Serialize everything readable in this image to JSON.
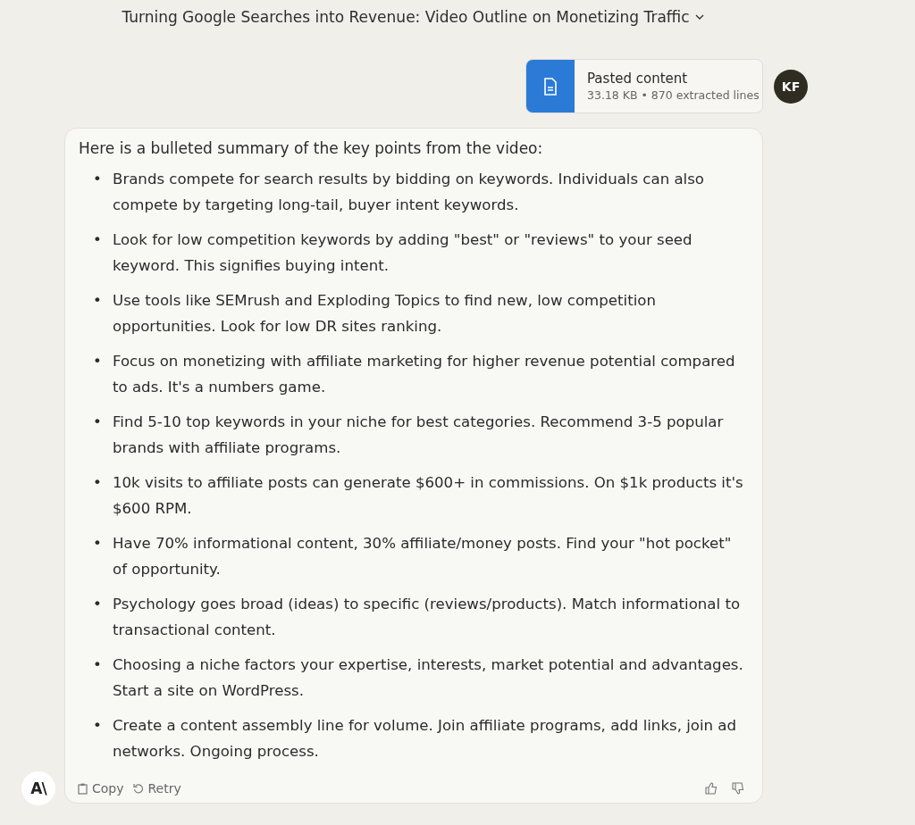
{
  "conversation_title": "Turning Google Searches into Revenue: Video Outline on Monetizing Traffic",
  "user_message": {
    "attachment": {
      "name": "Pasted content",
      "meta": "33.18 KB • 870 extracted lines"
    },
    "avatar_initials": "KF"
  },
  "assistant_message": {
    "logo_text": "A\\",
    "intro": "Here is a bulleted summary of the key points from the video:",
    "bullets": [
      {
        "marker": "•",
        "text": "Brands compete for search results by bidding on keywords. Individuals can also compete by targeting long-tail, buyer intent keywords."
      },
      {
        "marker": "•",
        "text": "Look for low competition keywords by adding \"best\" or \"reviews\" to your seed keyword. This signifies buying intent."
      },
      {
        "marker": "•",
        "text": "Use tools like SEMrush and Exploding Topics to find new, low competition opportunities. Look for low DR sites ranking."
      },
      {
        "marker": "•",
        "text": "Focus on monetizing with affiliate marketing for higher revenue potential compared to ads. It's a numbers game."
      },
      {
        "marker": "•",
        "text": "Find 5-10 top keywords in your niche for best categories. Recommend 3-5 popular brands with affiliate programs."
      },
      {
        "marker": "•",
        "text": "10k visits to affiliate posts can generate $600+ in commissions. On $1k products it's $600 RPM."
      },
      {
        "marker": "•",
        "text": "Have 70% informational content, 30% affiliate/money posts. Find your \"hot pocket\" of opportunity."
      },
      {
        "marker": "•",
        "text": "Psychology goes broad (ideas) to specific (reviews/products). Match informational to transactional content."
      },
      {
        "marker": "•",
        "text": "Choosing a niche factors your expertise, interests, market potential and advantages. Start a site on WordPress."
      },
      {
        "marker": "•",
        "text": "Create a content assembly line for volume. Join affiliate programs, add links, join ad networks. Ongoing process."
      }
    ],
    "actions": [
      {
        "label": "Copy",
        "kind": "copy"
      },
      {
        "label": "Retry",
        "kind": "retry"
      }
    ]
  }
}
